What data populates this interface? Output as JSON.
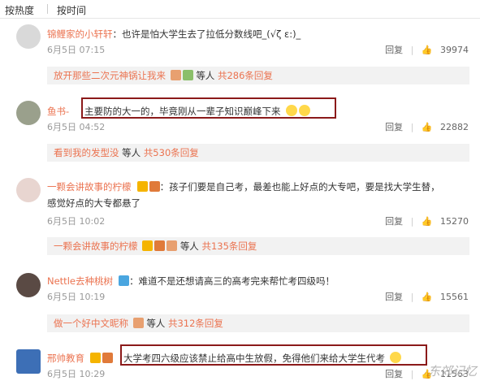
{
  "sort": {
    "hot": "按热度",
    "time": "按时间"
  },
  "comments": [
    {
      "user": "锦鲤家的小轩轩",
      "text": "：也许是怕大学生去了拉低分数线吧_(√ζ ε:)_",
      "date": "6月5日 07:15",
      "reply_label": "回复",
      "likes": "39974",
      "sub": {
        "text": "放开那些二次元神锅让我来",
        "tail": " 等人 ",
        "count": "共286条回复"
      }
    },
    {
      "user": "鱼书-",
      "text": "主要防的大一的，毕竟刚从一辈子知识巅峰下来",
      "date": "6月5日 04:52",
      "reply_label": "回复",
      "likes": "22882",
      "sub": {
        "text": "看到我的发型没",
        "tail": " 等人 ",
        "count": "共530条回复"
      }
    },
    {
      "user": "一颗会讲故事的柠檬",
      "text": "：孩子们要是自己考，最差也能上好点的大专吧，要是找大学生替，",
      "text2": "感觉好点的大专都悬了",
      "date": "6月5日 10:02",
      "reply_label": "回复",
      "likes": "15270",
      "sub": {
        "text": "一颗会讲故事的柠檬",
        "tail": " 等人 ",
        "count": "共135条回复"
      }
    },
    {
      "user": "Nettle去种桃树",
      "text": "：难道不是还想请高三的高考完来帮忙考四级吗！",
      "date": "6月5日 10:19",
      "reply_label": "回复",
      "likes": "15561",
      "sub": {
        "text": "做一个好中文昵称",
        "tail": " 等人 ",
        "count": "共312条回复"
      }
    },
    {
      "user": "邢帅教育",
      "text": "大学考四六级应该禁止给高中生放假，免得他们来给大学生代考",
      "date": "6月5日 10:29",
      "reply_label": "回复",
      "likes": "11563"
    }
  ],
  "watermark": "东郊记忆",
  "avatar_colors": [
    "#d9d9d9",
    "#9aa08c",
    "#e8d5d0",
    "#5a4a44",
    "#3d6fb6"
  ],
  "accent": "#eb7350"
}
